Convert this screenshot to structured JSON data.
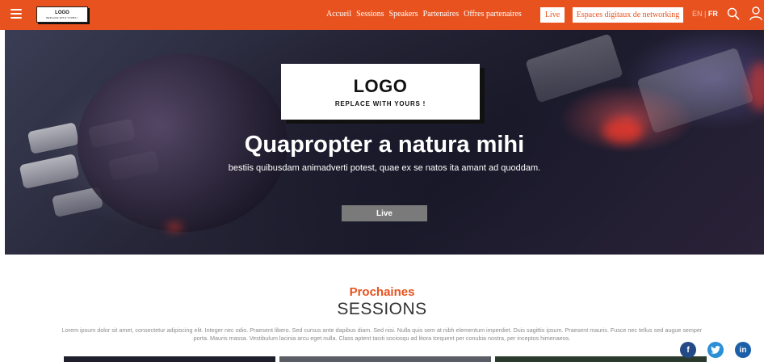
{
  "header": {
    "menu_icon": "hamburger-icon",
    "logo": {
      "line1": "LOGO",
      "line2": "REPLACE WITH YOURS !"
    },
    "nav": [
      "Accueil",
      "Sessions",
      "Speakers",
      "Partenaires",
      "Offres partenaires"
    ],
    "live_label": "Live",
    "networking_label": "Espaces digitaux de networking",
    "lang": {
      "en": "EN",
      "sep": "|",
      "fr": "FR"
    },
    "search_icon": "search-icon",
    "user_icon": "user-icon",
    "accent_color": "#e8521f"
  },
  "hero": {
    "logo_big": "LOGO",
    "logo_small": "REPLACE WITH YOURS !",
    "title": "Quapropter a natura mihi",
    "subtitle": "bestiis quibusdam animadverti potest, quae ex se natos ita amant ad quoddam.",
    "live_label": "Live"
  },
  "sessions": {
    "kicker": "Prochaines",
    "title": "SESSIONS",
    "description": "Lorem ipsum dolor sit amet, consectetur adipiscing elit. Integer nec odio. Praesent libero. Sed cursus ante dapibus diam. Sed nisi. Nulla quis sem at nibh elementum imperdiet. Duis sagittis ipsum. Praesent mauris. Fusce nec tellus sed augue semper porta. Mauris massa. Vestibulum lacinia arcu eget nulla. Class aptent taciti sociosqu ad litora torquent per conubia nostra, per inceptos himenaeos."
  },
  "social": {
    "facebook": {
      "glyph": "f",
      "icon": "facebook-icon"
    },
    "twitter": {
      "glyph": "t",
      "icon": "twitter-icon"
    },
    "linkedin": {
      "glyph": "in",
      "icon": "linkedin-icon"
    }
  }
}
